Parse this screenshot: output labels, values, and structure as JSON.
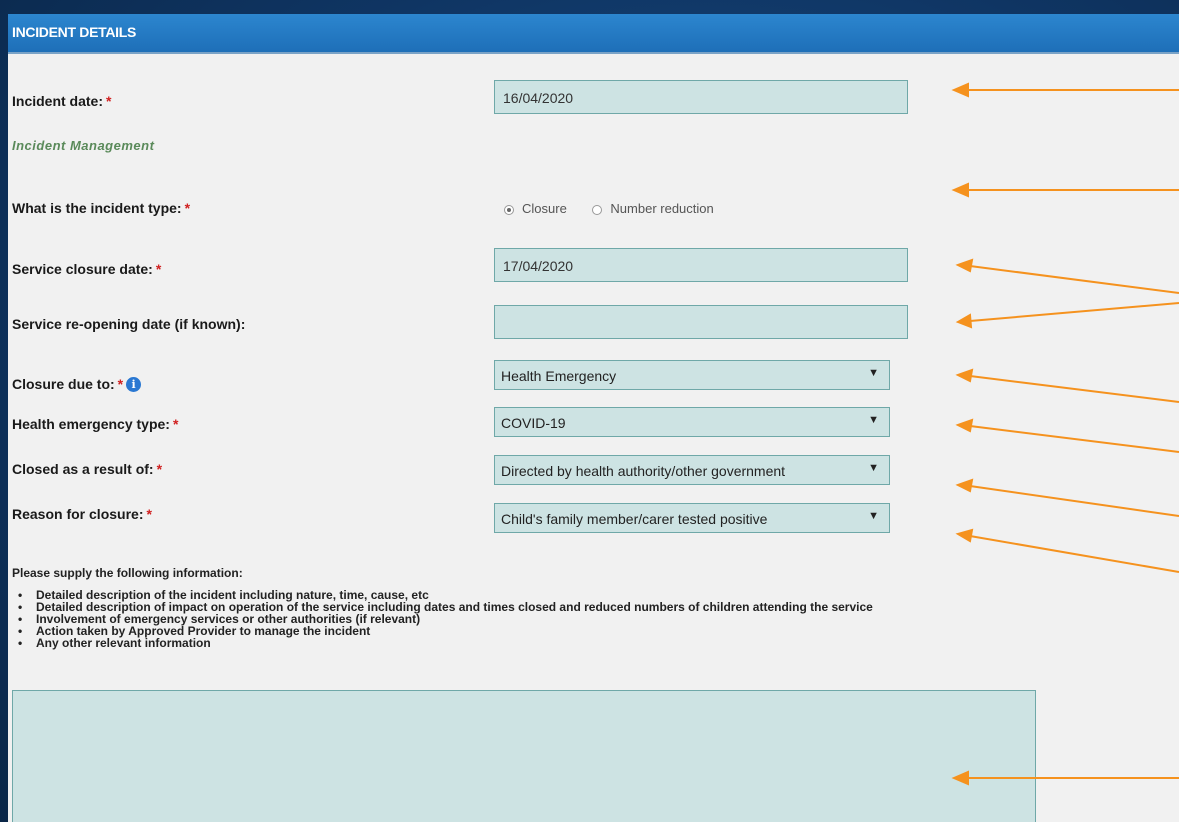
{
  "panel": {
    "title": "INCIDENT DETAILS"
  },
  "required_mark": "*",
  "incident_date": {
    "label": "Incident date:",
    "value": "16/04/2020"
  },
  "section_title": "Incident Management",
  "incident_type": {
    "label": "What is the incident type:",
    "options": [
      "Closure",
      "Number reduction"
    ],
    "selected": "Closure"
  },
  "closure_date": {
    "label": "Service closure date:",
    "value": "17/04/2020"
  },
  "reopening_date": {
    "label": "Service re-opening date (if known):",
    "value": ""
  },
  "closure_due_to": {
    "label": "Closure due to:",
    "value": "Health Emergency",
    "info_icon": "info-icon"
  },
  "health_emergency_type": {
    "label": "Health emergency type:",
    "value": "COVID-19"
  },
  "closed_result_of": {
    "label": "Closed as a result of:",
    "value": "Directed by health authority/other government"
  },
  "reason_for_closure": {
    "label": "Reason for closure:",
    "value": "Child's family member/carer tested positive"
  },
  "instructions": {
    "intro": "Please supply the following information:",
    "bullets": [
      "Detailed description of the incident including nature, time, cause, etc",
      "Detailed description of impact on operation of the service including dates and times closed and reduced numbers of children attending the service",
      "Involvement of emergency services or other authorities (if relevant)",
      "Action taken by Approved Provider to manage the incident",
      "Any other relevant information"
    ]
  },
  "description": {
    "value": ""
  },
  "colors": {
    "header": "#1e6fb8",
    "field_bg": "#cde3e3",
    "arrow": "#f5921e",
    "required": "#d02020"
  }
}
